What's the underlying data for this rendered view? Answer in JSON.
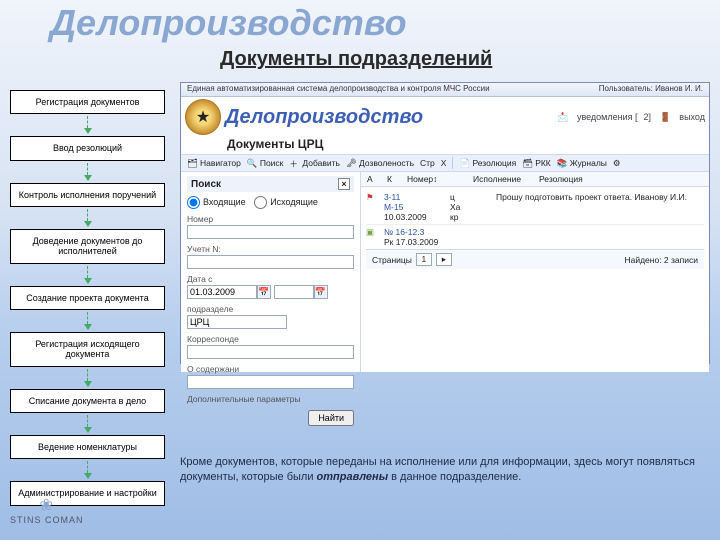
{
  "page": {
    "title1": "Делопроизводство",
    "title2": "Документы подразделений"
  },
  "sidebar": {
    "items": [
      {
        "label": "Регистрация документов"
      },
      {
        "label": "Ввод резолюций"
      },
      {
        "label": "Контроль исполнения поручений"
      },
      {
        "label": "Доведение документов до исполнителей"
      },
      {
        "label": "Создание проекта документа"
      },
      {
        "label": "Регистрация исходящего документа"
      },
      {
        "label": "Списание документа в дело"
      },
      {
        "label": "Ведение номенклатуры"
      },
      {
        "label": "Администрирование и настройки"
      }
    ]
  },
  "app": {
    "system_line": "Единая автоматизированная система делопроизводства и контроля МЧС России",
    "user_label": "Пользователь:",
    "user_name": "Иванов И. И.",
    "brand": "Делопроизводство",
    "subhead": "Документы ЦРЦ",
    "brand_tools": {
      "notify": "уведомления",
      "notify_count": "2",
      "exit": "выход"
    },
    "toolbar": {
      "nav": "Навигатор",
      "search": "Поиск",
      "add": "Добавить",
      "access": "Дозволеность",
      "page": "Стр",
      "close": "X",
      "res": "Резолюция",
      "rkk": "РКК",
      "journals": "Журналы",
      "settings_icon": "set"
    },
    "toolbar2": {
      "a": "А",
      "k": "К",
      "num": "Номер",
      "exec": "Исполнение",
      "res": "Резолюция"
    },
    "search": {
      "title": "Поиск",
      "radio1": "Входящие",
      "radio2": "Исходящие",
      "f_num": "Номер",
      "f_uch": "Учетн N:",
      "f_date": "Дата с",
      "date_value": "01.03.2009",
      "f_dept": "подразделе",
      "dept_value": "ЦРЦ",
      "f_corr": "Корреспонде",
      "f_cont": "О содержани",
      "f_extra": "Дополнительные параметры",
      "find": "Найти"
    },
    "results": {
      "rows": [
        {
          "num": "3-11",
          "exec": "ц",
          "res": "Прошу подготовить проект ответа. Иванову И.И.",
          "sub1": "М-15",
          "sub2": "Ха",
          "date": "10.03.2009",
          "k": "кр"
        },
        {
          "num": "",
          "exec": "",
          "res": "",
          "sub1": "№ 16-12.3",
          "sub2": "",
          "date": "Рк 17.03.2009",
          "k": ""
        }
      ],
      "pager_label": "Страницы",
      "pager_cur": "1",
      "pager_total": "▸",
      "found": "Найдено: 2 записи"
    }
  },
  "caption": {
    "t1": "Кроме документов, которые переданы на исполнение или для информации, здесь могут появляться документы, которые были ",
    "em": "отправлены",
    "t2": " в данное подразделение."
  },
  "logo": {
    "mark": "❀",
    "text": "STINS COMAN"
  }
}
